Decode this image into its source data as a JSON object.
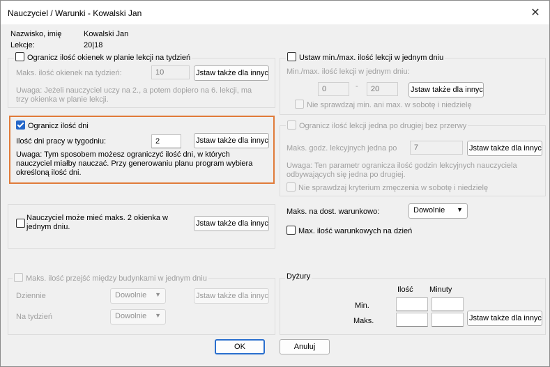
{
  "window": {
    "title": "Nauczyciel / Warunki - Kowalski Jan",
    "close_icon": "close-icon"
  },
  "info": {
    "name_label": "Nazwisko, imię",
    "name_value": "Kowalski Jan",
    "lessons_label": "Lekcje:",
    "lessons_value": "20|18"
  },
  "windows_group": {
    "checkbox_label": "Ogranicz ilość okienek w planie lekcji na tydzień",
    "max_label": "Maks. ilość okienek na tydzień:",
    "max_value": "10",
    "apply_button": "Jstaw także dla innych",
    "note": "Uwaga: Jeżeli nauczyciel uczy na 2., a potem dopiero na 6. lekcji, ma trzy okienka w planie lekcji."
  },
  "days_group": {
    "checkbox_label": "Ogranicz ilość dni",
    "days_label": "Ilość dni pracy w tygodniu:",
    "days_value": "2",
    "apply_button": "Jstaw także dla innych",
    "note": "Uwaga: Tym sposobem możesz ograniczyć ilość dni, w których nauczyciel miałby nauczać. Przy generowaniu planu program wybiera określoną ilość dni."
  },
  "gaps_group": {
    "checkbox_label": "Nauczyciel może mieć maks. 2 okienka w jednym dniu.",
    "apply_button": "Jstaw także dla innych"
  },
  "buildings_group": {
    "checkbox_label": "Maks. ilość przejść między budynkami w jednym dniu",
    "daily_label": "Dziennie",
    "daily_value": "Dowolnie",
    "weekly_label": "Na tydzień",
    "weekly_value": "Dowolnie",
    "apply_button": "Jstaw także dla innych"
  },
  "minmax_group": {
    "checkbox_label": "Ustaw min./max. ilość lekcji w jednym dniu",
    "range_label": "Min./max. ilość lekcji w jednym dniu:",
    "min_value": "0",
    "dash": "-",
    "max_value": "20",
    "apply_button": "Jstaw także dla innych",
    "weekend_label": "Nie sprawdzaj min. ani max. w sobotę i niedzielę"
  },
  "consecutive_group": {
    "checkbox_label": "Ogranicz ilość lekcji jedna po drugiej bez przerwy",
    "max_label": "Maks. godz. lekcyjnych jedna po",
    "max_value": "7",
    "apply_button": "Jstaw także dla innych",
    "note": "Uwaga: Ten parametr ogranicza ilość godzin lekcyjnych nauczyciela odbywających się jedna po drugiej.",
    "weekend_label": "Nie sprawdzaj kryterium zmęczenia w sobotę i niedzielę"
  },
  "conditional": {
    "label": "Maks. na dost. warunkowo:",
    "select_value": "Dowolnie",
    "checkbox_label": "Max. ilość warunkowych na dzień"
  },
  "duty": {
    "legend": "Dyżury",
    "col_count": "Ilość",
    "col_minutes": "Minuty",
    "row_min": "Min.",
    "row_max": "Maks.",
    "apply_button": "Jstaw także dla innych"
  },
  "footer": {
    "ok": "OK",
    "cancel": "Anuluj"
  },
  "colors": {
    "highlight": "#e07b39",
    "checkbox_checked": "#2366c9",
    "ok_border": "#2a6fce"
  }
}
